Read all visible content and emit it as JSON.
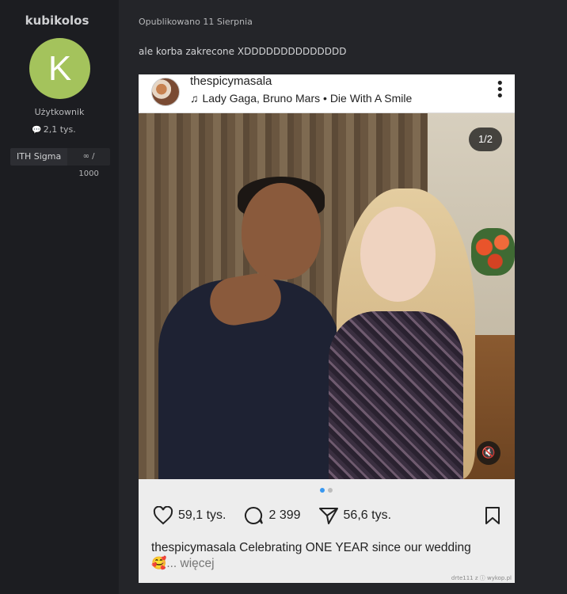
{
  "author": {
    "name": "kubikolos",
    "avatar_letter": "K",
    "avatar_color": "#a4c35c",
    "role": "Użytkownik",
    "posts_count": "2,1 tys.",
    "badge_name": "ITH Sigma",
    "badge_rep": "∞ / 1000"
  },
  "post": {
    "date": "Opublikowano 11 Sierpnia",
    "text": "ale korba zakrecone XDDDDDDDDDDDDDD"
  },
  "embed": {
    "username": "thespicymasala",
    "music": "Lady Gaga, Bruno Mars • Die With A Smile",
    "counter": "1/2",
    "likes": "59,1 tys.",
    "comments": "2 399",
    "shares": "56,6 tys.",
    "caption_user": "thespicymasala",
    "caption_text": " Celebrating ONE YEAR since our wedding",
    "caption_emoji": "🥰",
    "caption_more": "... więcej",
    "watermark": "drte111 z ⓘ wykop.pl"
  }
}
